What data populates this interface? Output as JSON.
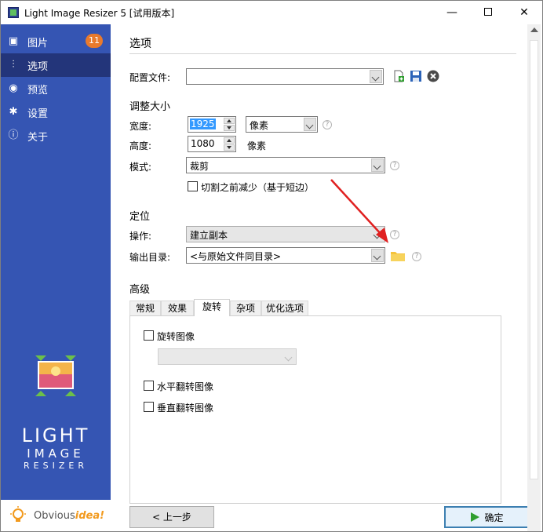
{
  "window": {
    "title": "Light Image Resizer 5  [试用版本]",
    "minimize": "—",
    "close": "✕"
  },
  "sidebar": {
    "items": [
      {
        "label": "图片",
        "icon": "images-icon",
        "glyph": "▣",
        "badge": "11"
      },
      {
        "label": "选项",
        "icon": "sliders-icon",
        "glyph": "⫶"
      },
      {
        "label": "预览",
        "icon": "eye-icon",
        "glyph": "◉"
      },
      {
        "label": "设置",
        "icon": "gear-icon",
        "glyph": "✱"
      },
      {
        "label": "关于",
        "icon": "info-icon",
        "glyph": "ⓘ"
      }
    ],
    "active_index": 1,
    "logo_lines": [
      "LIGHT",
      "IMAGE",
      "RESIZER"
    ],
    "brand_prefix": "Obvious",
    "brand_suffix": "idea!"
  },
  "options": {
    "title": "选项",
    "profile_label": "配置文件:",
    "profile_value": "",
    "resize_section": "调整大小",
    "width_label": "宽度:",
    "width_value": "1925",
    "unit_value": "像素",
    "height_label": "高度:",
    "height_value": "1080",
    "height_unit": "像素",
    "mode_label": "模式:",
    "mode_value": "裁剪",
    "shrink_checkbox": "切割之前减少（基于短边）",
    "shrink_checked": false,
    "position_section": "定位",
    "operation_label": "操作:",
    "operation_value": "建立副本",
    "output_label": "输出目录:",
    "output_value": "<与原始文件同目录>",
    "advanced_section": "高级",
    "tabs": [
      "常规",
      "效果",
      "旋转",
      "杂项",
      "优化选项"
    ],
    "active_tab": 2,
    "rotate_checkbox": "旋转图像",
    "rotate_select_value": "",
    "flip_h_checkbox": "水平翻转图像",
    "flip_v_checkbox": "垂直翻转图像"
  },
  "footer": {
    "back_label": "< 上一步",
    "ok_label": "确定"
  },
  "colors": {
    "sidebar": "#3555b3",
    "sidebar_active": "#23357a",
    "badge": "#e97a2c",
    "annotation_arrow": "#e02020",
    "folder": "#f5c33b"
  }
}
